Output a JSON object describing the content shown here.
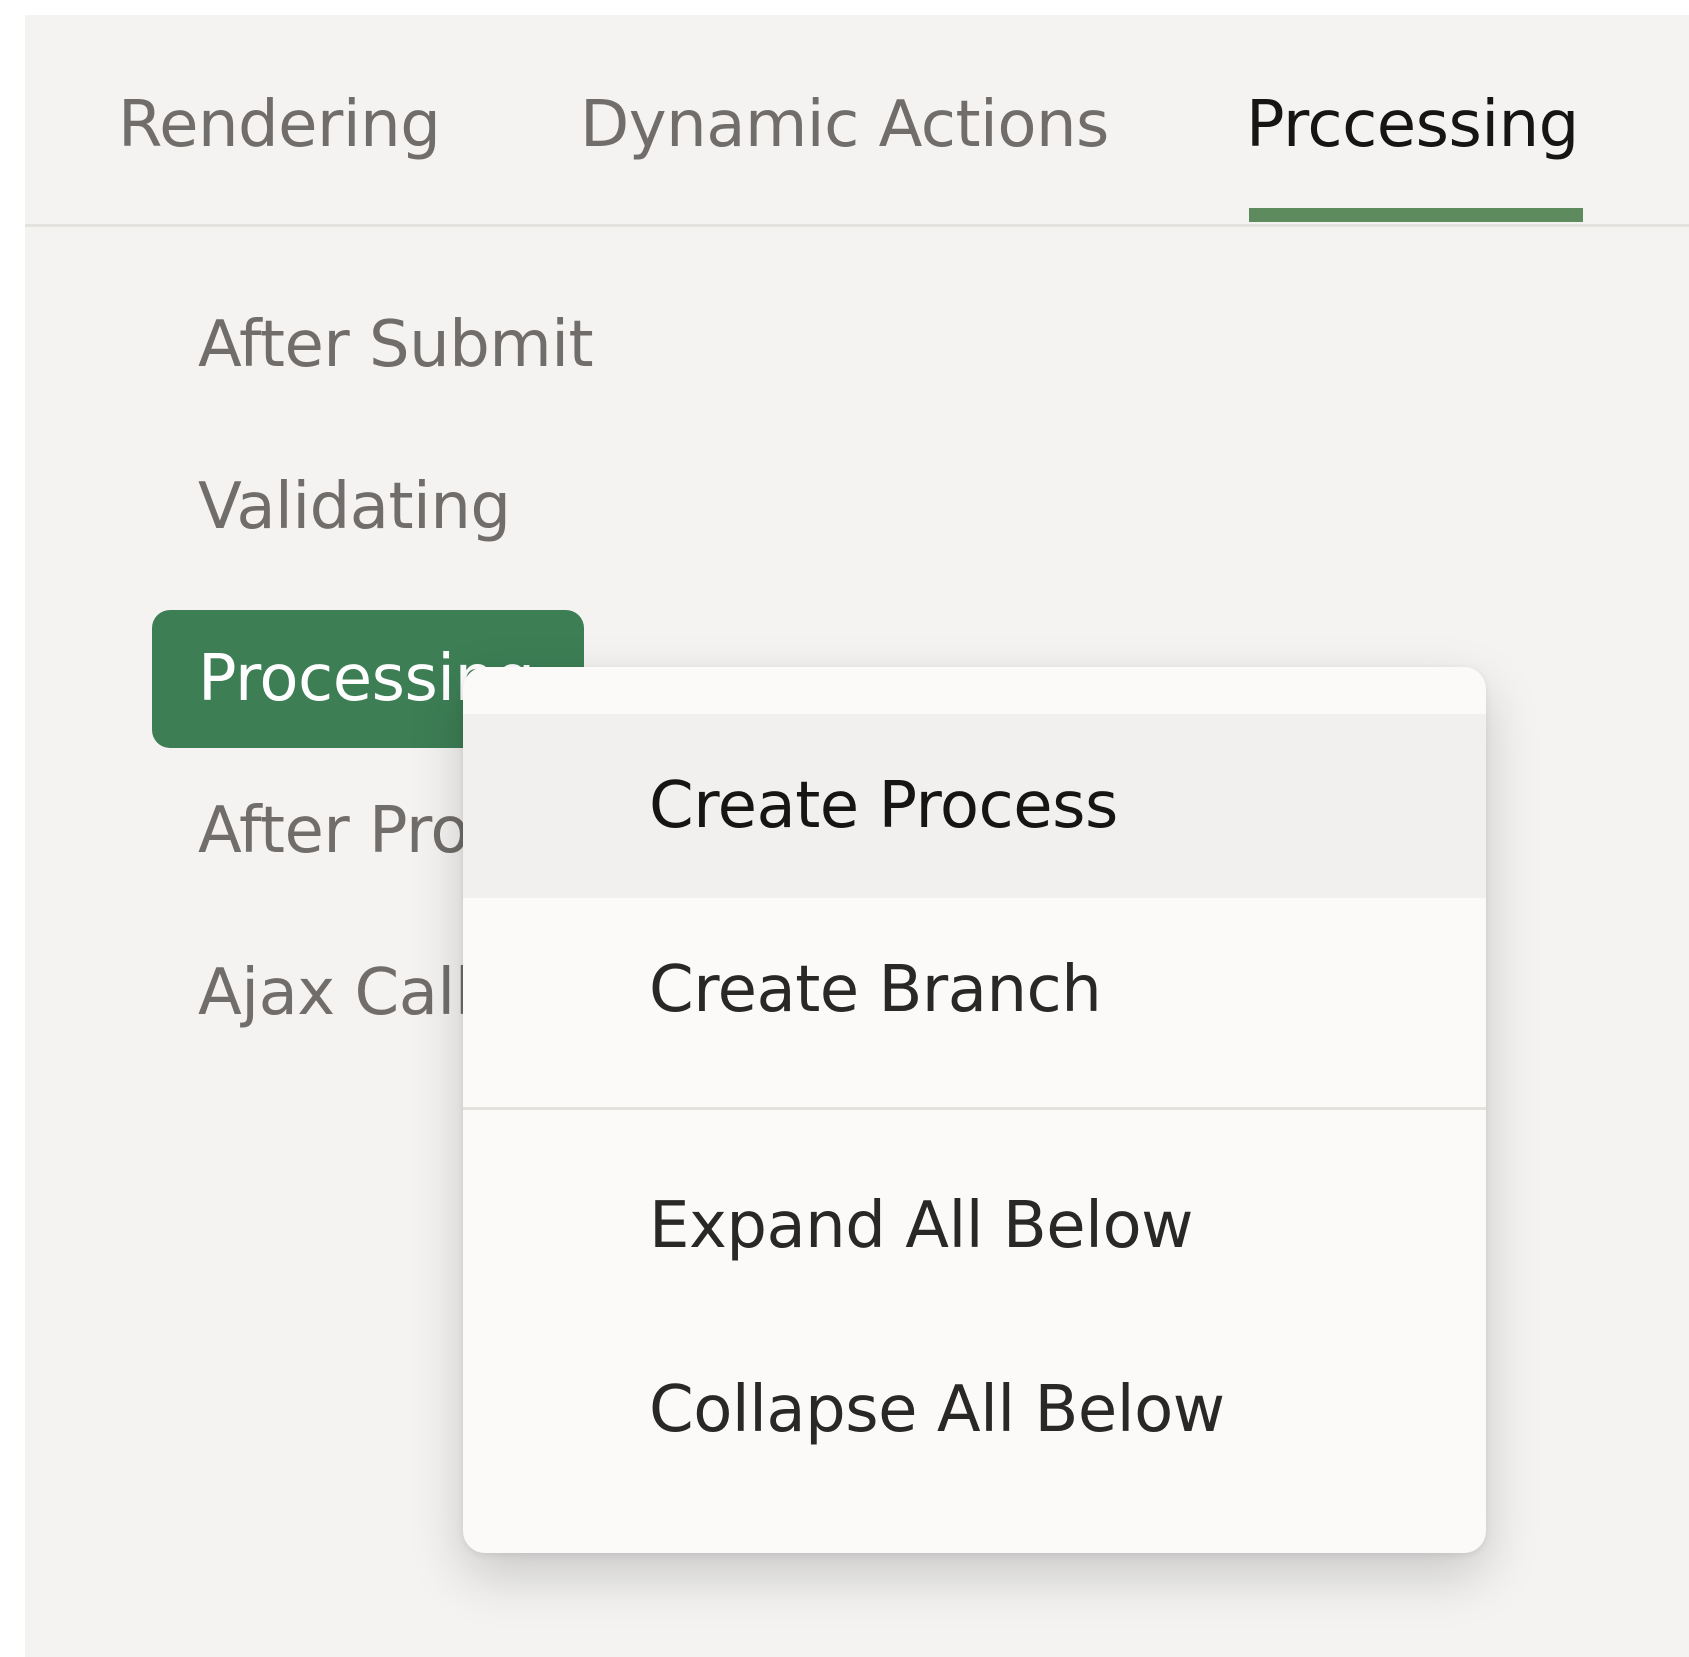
{
  "tabs": {
    "items": [
      {
        "label": "Rendering"
      },
      {
        "label": "Dynamic Actions"
      },
      {
        "label": "Prccessing"
      }
    ],
    "active_index": 2
  },
  "tree": {
    "items": [
      {
        "label": "After Submit"
      },
      {
        "label": "Validating"
      },
      {
        "label": "Processing"
      },
      {
        "label": "After Processing"
      },
      {
        "label": "Ajax Callback"
      }
    ],
    "selected_index": 2
  },
  "context_menu": {
    "items": [
      {
        "label": "Create Process"
      },
      {
        "label": "Create Branch"
      },
      {
        "label": "Expand All Below"
      },
      {
        "label": "Collapse All Below"
      }
    ],
    "highlighted_index": 0
  },
  "colors": {
    "accent_green": "#3d7e55",
    "tab_indicator": "#5d8b5d",
    "panel_bg": "#f4f3f2",
    "menu_bg": "#fbfaf9"
  }
}
